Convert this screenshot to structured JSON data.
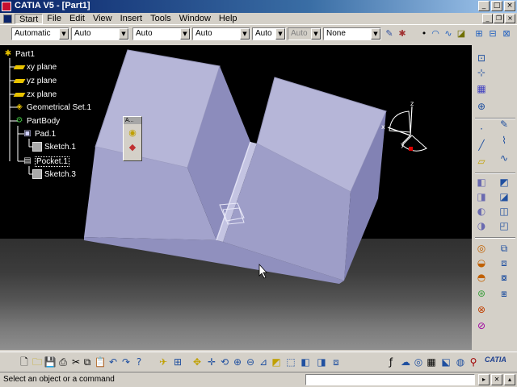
{
  "window": {
    "title": "CATIA V5 - [Part1]"
  },
  "menu": [
    "Start",
    "File",
    "Edit",
    "View",
    "Insert",
    "Tools",
    "Window",
    "Help"
  ],
  "toolbar": {
    "combos": [
      {
        "value": "Automatic",
        "disabled": false
      },
      {
        "value": "Auto",
        "disabled": false
      },
      {
        "value": "Auto",
        "disabled": false
      },
      {
        "value": "Auto",
        "disabled": false
      },
      {
        "value": "Auto",
        "disabled": false
      },
      {
        "value": "Auto",
        "disabled": true
      },
      {
        "value": "None",
        "disabled": false
      }
    ]
  },
  "tree": {
    "root": "Part1",
    "xy_plane": "xy plane",
    "yz_plane": "yz plane",
    "zx_plane": "zx plane",
    "geometrical_set": "Geometrical Set.1",
    "part_body": "PartBody",
    "pad": "Pad.1",
    "pad_sketch": "Sketch.1",
    "pocket": "Pocket.1",
    "pocket_sketch": "Sketch.3"
  },
  "floating_toolbar": {
    "title": "A..."
  },
  "compass": {
    "x": "x",
    "y": "y",
    "z": "z"
  },
  "mini_axis": {
    "x": "x",
    "y": "y",
    "z": "z"
  },
  "status": {
    "message": "Select an object or a command"
  },
  "logo": "CATIA",
  "colors": {
    "part_face_light": "#b3b3d6",
    "part_face_mid": "#9e9ec8",
    "part_face_dark": "#8282b4",
    "title_gradient": "#0a246a"
  }
}
